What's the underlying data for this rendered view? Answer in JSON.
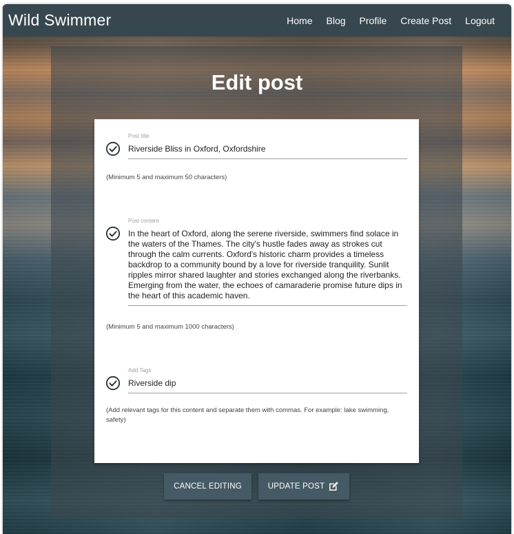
{
  "navbar": {
    "brand": "Wild Swimmer",
    "links": [
      "Home",
      "Blog",
      "Profile",
      "Create Post",
      "Logout"
    ]
  },
  "page": {
    "title": "Edit post"
  },
  "form": {
    "title": {
      "label": "Post title",
      "value": "Riverside Bliss in Oxford, Oxfordshire",
      "helper": "(Minimum 5 and maximum 50 characters)"
    },
    "content": {
      "label": "Post content",
      "value": "In the heart of Oxford, along the serene riverside, swimmers find solace in the waters of the Thames. The city's hustle fades away as strokes cut through the calm currents. Oxford's historic charm provides a timeless backdrop to a community bound by a love for riverside tranquility. Sunlit ripples mirror shared laughter and stories exchanged along the riverbanks. Emerging from the water, the echoes of camaraderie promise future dips in the heart of this academic haven.",
      "helper": "(Minimum 5 and maximum 1000 characters)"
    },
    "tags": {
      "label": "Add Tags",
      "value": "Riverside dip",
      "helper": "(Add relevant tags for this content and separate them with commas. For example: lake swimming, safety)"
    }
  },
  "buttons": {
    "cancel": "Cancel editing",
    "update": "Update post"
  },
  "colors": {
    "navbar": "#37474f",
    "button": "#455a64",
    "card": "#ffffff"
  },
  "icons": {
    "field_status": "check-circle-icon",
    "update_button": "edit-icon"
  }
}
